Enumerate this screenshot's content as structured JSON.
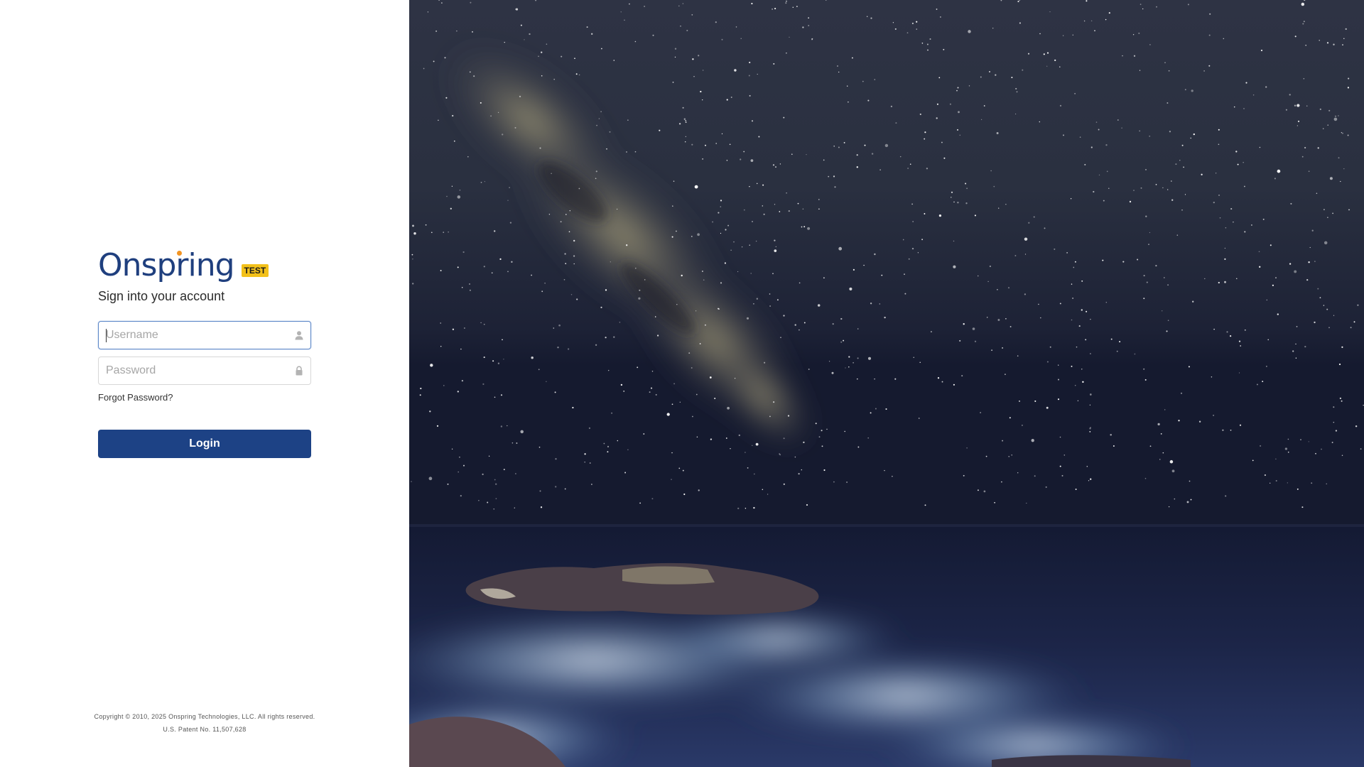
{
  "brand": {
    "name": "Onspring",
    "environment_badge": "TEST",
    "colors": {
      "brand_blue": "#1f3f7e",
      "badge_yellow": "#f3c11a",
      "logo_dot_orange": "#f29423",
      "button_blue": "#1d4285"
    }
  },
  "login": {
    "subtitle": "Sign into your account",
    "username_placeholder": "Username",
    "username_value": "",
    "username_icon": "user-icon",
    "password_placeholder": "Password",
    "password_value": "",
    "password_icon": "lock-icon",
    "forgot_password_label": "Forgot Password?",
    "login_button_label": "Login"
  },
  "footer": {
    "copyright": "Copyright © 2010, 2025 Onspring Technologies, LLC. All rights reserved.",
    "patent": "U.S. Patent No. 11,507,628"
  },
  "background": {
    "image": "night-sky-milky-way-over-ocean-rocks"
  }
}
